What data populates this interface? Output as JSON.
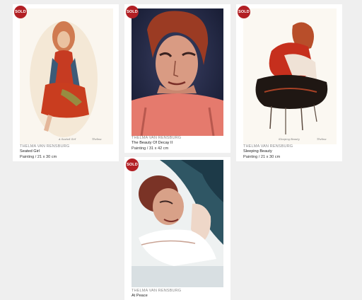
{
  "colors": {
    "page_background": "#efefef",
    "card_background": "#ffffff",
    "sold_badge": "#b21f24",
    "artist_text": "#8a8a8a"
  },
  "artworks": [
    {
      "badge": "SOLD",
      "artist": "THELMA VAN RENSBURG",
      "title": "Seated Girl",
      "spec": "Painting / 21 x 30 cm",
      "caption": "A Seated Girl",
      "signature": "Thelma"
    },
    {
      "badge": "SOLD",
      "artist": "THELMA VAN RENSBURG",
      "title": "The Beauty Of Decay II",
      "spec": "Painting / 31 x 42 cm"
    },
    {
      "badge": "SOLD",
      "artist": "THELMA VAN RENSBURG",
      "title": "Sleeping Beauty",
      "spec": "Painting / 21 x 30 cm",
      "caption": "Sleeping Beauty",
      "signature": "Thelma"
    },
    {
      "badge": "SOLD",
      "artist": "THELMA VAN RENSBURG",
      "title": "At Peace"
    }
  ]
}
